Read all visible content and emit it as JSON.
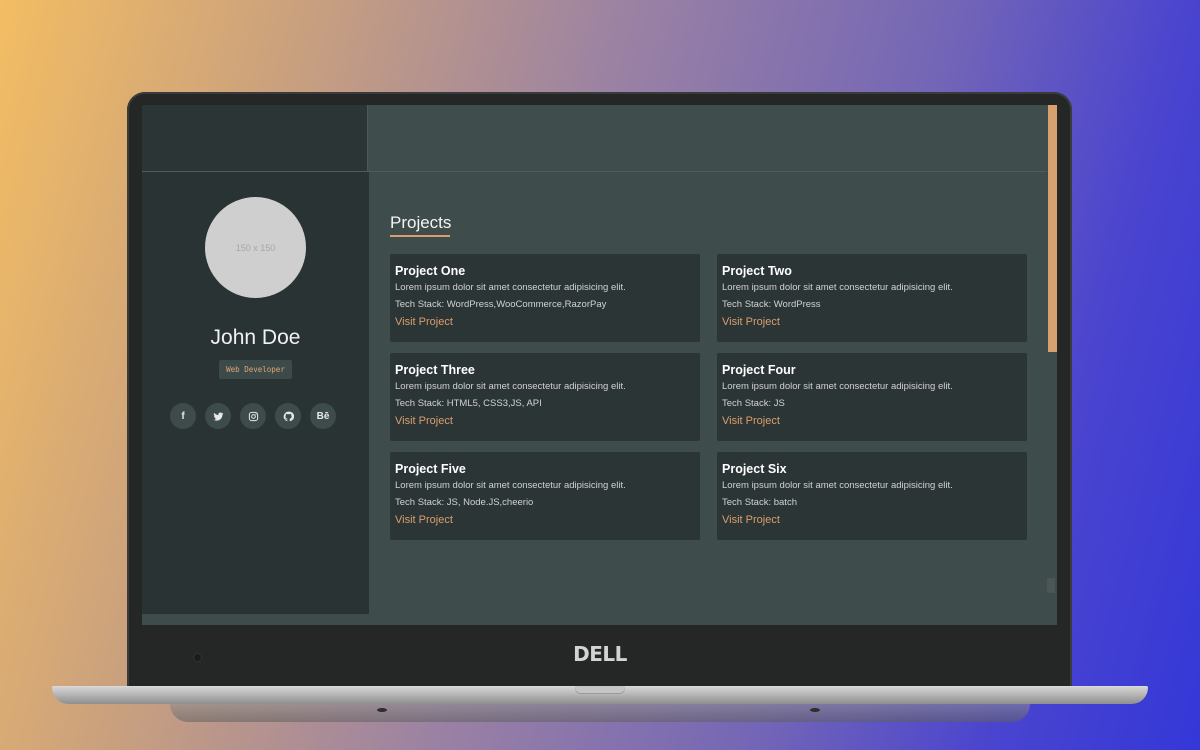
{
  "profile": {
    "avatar_placeholder": "150 x 150",
    "name": "John Doe",
    "role": "Web Developer"
  },
  "social": [
    {
      "icon": "facebook-icon",
      "glyph": "f"
    },
    {
      "icon": "twitter-icon",
      "glyph": ""
    },
    {
      "icon": "instagram-icon",
      "glyph": ""
    },
    {
      "icon": "github-icon",
      "glyph": ""
    },
    {
      "icon": "behance-icon",
      "glyph": "Bē"
    }
  ],
  "main": {
    "heading": "Projects",
    "projects": [
      {
        "title": "Project One",
        "description": "Lorem ipsum dolor sit amet consectetur adipisicing elit.",
        "stack": "Tech Stack: WordPress,WooCommerce,RazorPay",
        "link": "Visit Project"
      },
      {
        "title": "Project Two",
        "description": "Lorem ipsum dolor sit amet consectetur adipisicing elit.",
        "stack": "Tech Stack: WordPress",
        "link": "Visit Project"
      },
      {
        "title": "Project Three",
        "description": "Lorem ipsum dolor sit amet consectetur adipisicing elit.",
        "stack": "Tech Stack: HTML5, CSS3,JS, API",
        "link": "Visit Project"
      },
      {
        "title": "Project Four",
        "description": "Lorem ipsum dolor sit amet consectetur adipisicing elit.",
        "stack": "Tech Stack: JS",
        "link": "Visit Project"
      },
      {
        "title": "Project Five",
        "description": "Lorem ipsum dolor sit amet consectetur adipisicing elit.",
        "stack": "Tech Stack: JS, Node.JS,cheerio",
        "link": "Visit Project"
      },
      {
        "title": "Project Six",
        "description": "Lorem ipsum dolor sit amet consectetur adipisicing elit.",
        "stack": "Tech Stack: batch",
        "link": "Visit Project"
      }
    ]
  },
  "device": {
    "brand": "DELL"
  },
  "colors": {
    "accent": "#d99e6e",
    "sidebar": "#293334",
    "main": "#3e4d4c",
    "card": "#2b3536"
  }
}
